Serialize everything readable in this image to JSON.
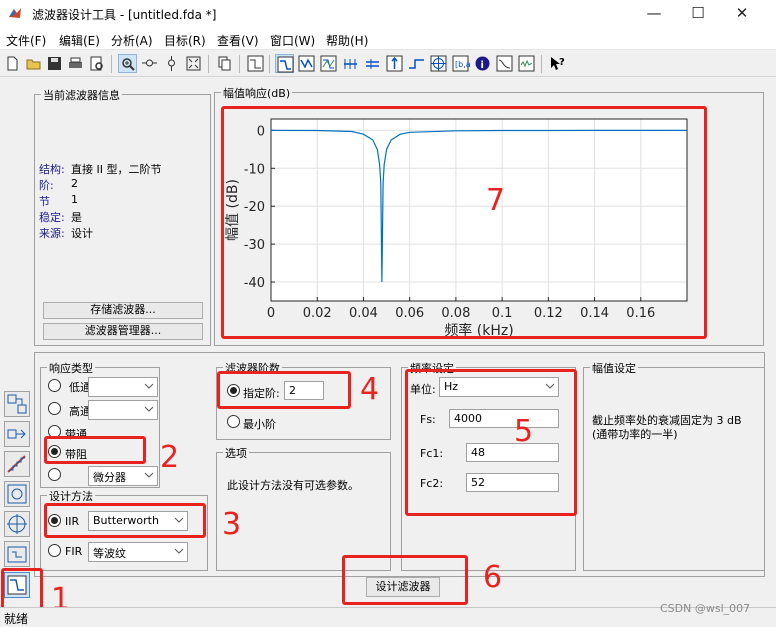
{
  "window": {
    "title": "滤波器设计工具 - [untitled.fda *]",
    "minimize": "—",
    "maximize": "☐",
    "close": "✕"
  },
  "menu": [
    "文件(F)",
    "编辑(E)",
    "分析(A)",
    "目标(R)",
    "查看(V)",
    "窗口(W)",
    "帮助(H)"
  ],
  "toolbar": [
    "new-icon",
    "open-icon",
    "save-icon",
    "print-icon",
    "print-preview-icon",
    "zoom-in-icon",
    "zoom-x-icon",
    "zoom-y-icon",
    "full-view-icon",
    "copy-icon",
    "filter-spec-icon",
    "magnitude-icon",
    "phase-icon",
    "mag-phase-icon",
    "group-delay-icon",
    "phase-delay-icon",
    "impulse-icon",
    "step-icon",
    "pole-zero-icon",
    "coefficients-icon",
    "info-icon",
    "magnitude-estimate-icon",
    "round-off-noise-icon",
    "whats-this-icon"
  ],
  "info_panel": {
    "title": "当前滤波器信息",
    "rows": [
      {
        "label": "结构:",
        "value": "直接 II 型，二阶节"
      },
      {
        "label": "阶:",
        "value": "2"
      },
      {
        "label": "节",
        "value": "1"
      },
      {
        "label": "稳定:",
        "value": "是"
      },
      {
        "label": "来源:",
        "value": "设计"
      }
    ],
    "store_button": "存储滤波器...",
    "manager_button": "滤波器管理器..."
  },
  "plot_panel": {
    "title": "幅值响应(dB)"
  },
  "chart_data": {
    "type": "line",
    "title": "",
    "xlabel": "频率 (kHz)",
    "ylabel": "幅值 (dB)",
    "xlim": [
      0,
      0.18
    ],
    "ylim": [
      -45,
      3
    ],
    "xticks": [
      "0",
      "0.02",
      "0.04",
      "0.06",
      "0.08",
      "0.1",
      "0.12",
      "0.14",
      "0.16"
    ],
    "xtick_values": [
      0,
      0.02,
      0.04,
      0.06,
      0.08,
      0.1,
      0.12,
      0.14,
      0.16
    ],
    "yticks": [
      "0",
      "-10",
      "-20",
      "-30",
      "-40"
    ],
    "ytick_values": [
      0,
      -10,
      -20,
      -30,
      -40
    ],
    "series": [
      {
        "x": [
          0,
          0.02,
          0.035,
          0.04,
          0.044,
          0.046,
          0.047,
          0.0475,
          0.048,
          0.0485,
          0.049,
          0.05,
          0.052,
          0.056,
          0.06,
          0.08,
          0.1,
          0.12,
          0.14,
          0.16,
          0.18
        ],
        "y": [
          0,
          -0.02,
          -0.3,
          -1.0,
          -2.5,
          -5,
          -9,
          -14,
          -40,
          -14,
          -9,
          -5,
          -2.5,
          -1.0,
          -0.5,
          -0.1,
          -0.04,
          -0.02,
          -0.01,
          -0.01,
          0
        ],
        "color": "#0072bd"
      }
    ]
  },
  "response_type": {
    "title": "响应类型",
    "lowpass": {
      "label": "低通"
    },
    "highpass": {
      "label": "高通"
    },
    "bandpass": {
      "label": "带通"
    },
    "bandstop": {
      "label": "带阻"
    },
    "differentiator": {
      "label": "微分器"
    }
  },
  "design_method": {
    "title": "设计方法",
    "iir": "IIR",
    "iir_value": "Butterworth",
    "fir": "FIR",
    "fir_value": "等波纹"
  },
  "filter_order": {
    "title": "滤波器阶数",
    "specify": "指定阶:",
    "order_value": "2",
    "minimum": "最小阶"
  },
  "options": {
    "title": "选项",
    "text": "此设计方法没有可选参数。"
  },
  "freq_spec": {
    "title": "频率设定",
    "units_label": "单位:",
    "units_value": "Hz",
    "fs_label": "Fs:",
    "fs_value": "4000",
    "fc1_label": "Fc1:",
    "fc1_value": "48",
    "fc2_label": "Fc2:",
    "fc2_value": "52"
  },
  "mag_spec": {
    "title": "幅值设定",
    "text": "截止频率处的衰减固定为 3 dB (通带功率的一半)"
  },
  "design_button": "设计滤波器",
  "status": "就绪",
  "watermark": "CSDN @wsl_007",
  "annotations": [
    "1",
    "2",
    "3",
    "4",
    "5",
    "6",
    "7"
  ]
}
